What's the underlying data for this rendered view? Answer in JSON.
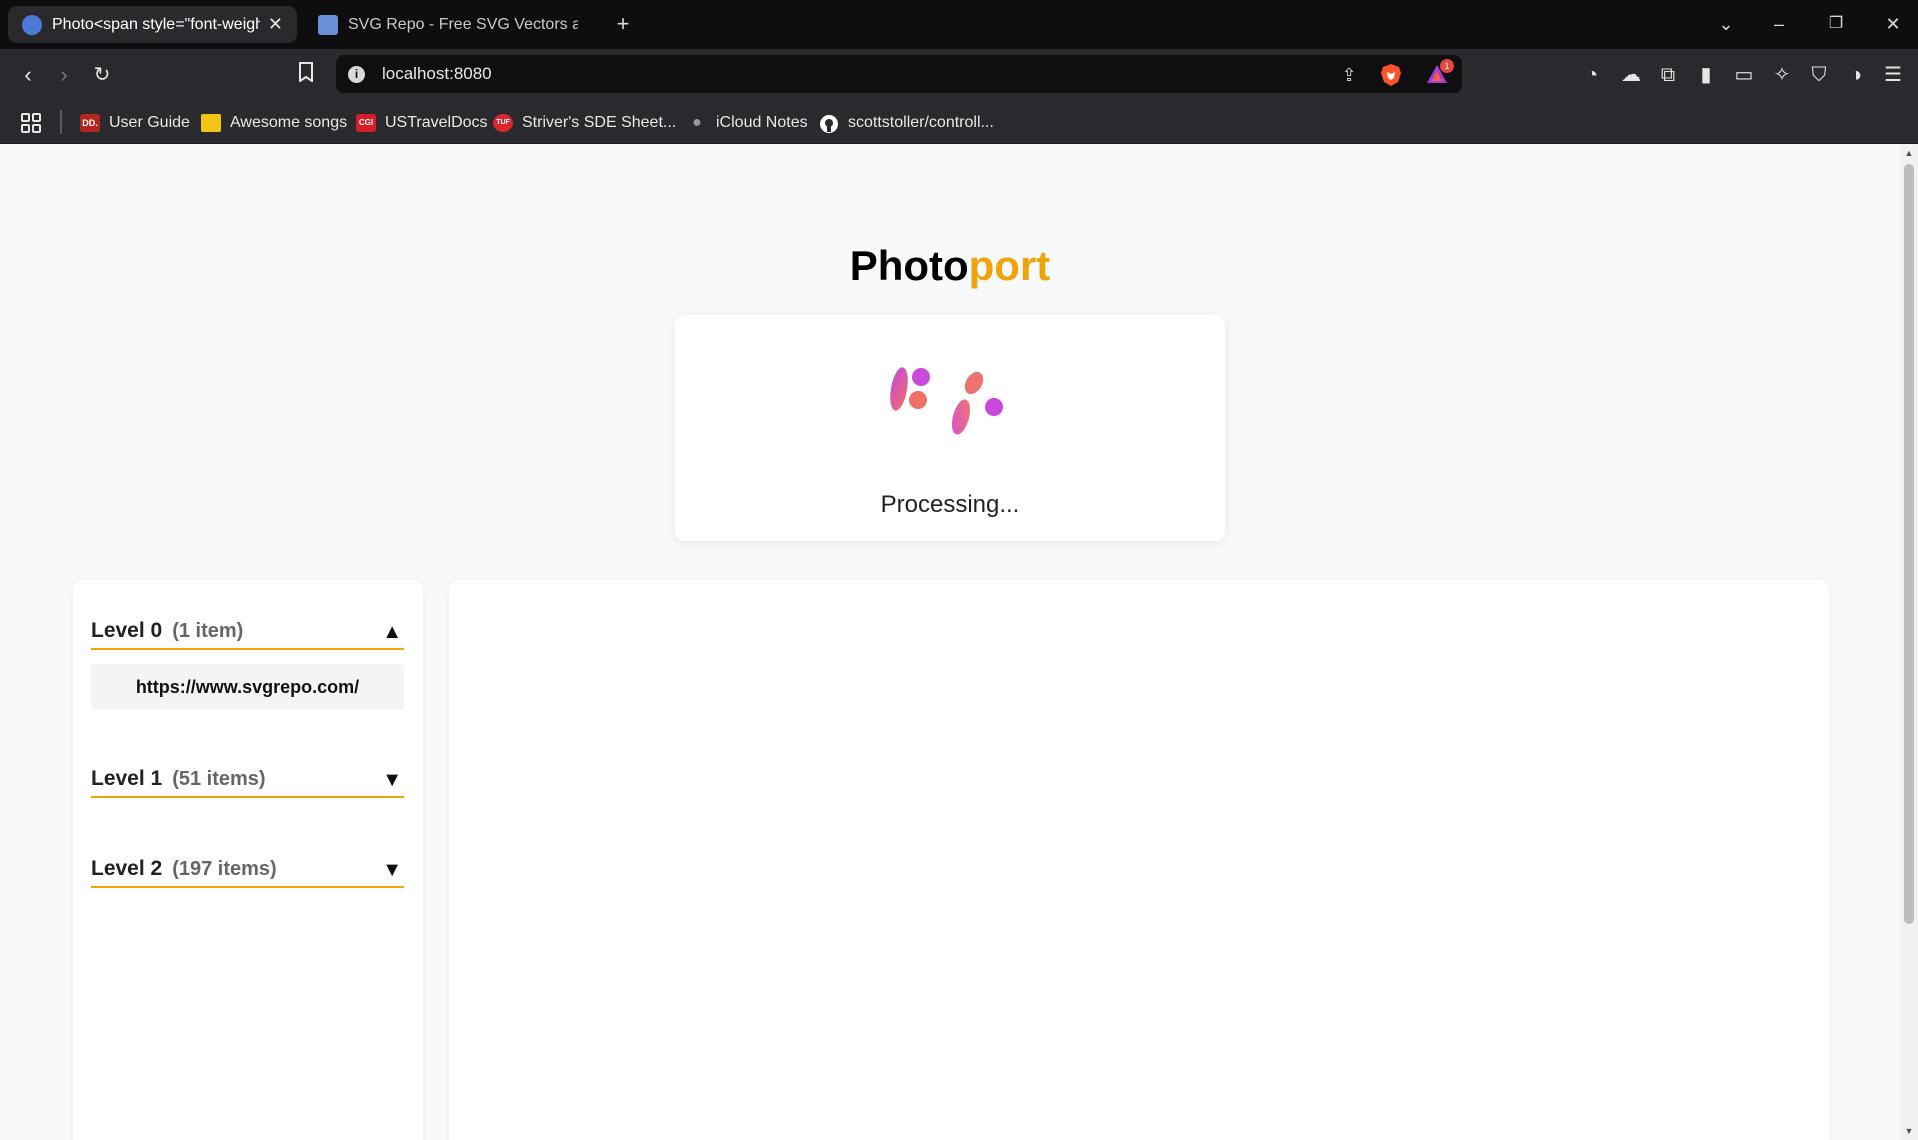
{
  "browser": {
    "tabs": [
      {
        "title": "Photo<span style=\"font-weight",
        "active": true
      },
      {
        "title": "SVG Repo - Free SVG Vectors and Ic",
        "active": false
      }
    ],
    "new_tab_label": "+",
    "address": "localhost:8080",
    "notification_count": "1",
    "bookmarks": [
      {
        "label": "User Guide",
        "icon": "dd-logo",
        "color": "#b3261e",
        "icon_text": "DD."
      },
      {
        "label": "Awesome songs",
        "icon": "folder-icon",
        "color": "#f2c418",
        "icon_text": ""
      },
      {
        "label": "USTravelDocs",
        "icon": "cgi-logo",
        "color": "#d71e28",
        "icon_text": "CGI"
      },
      {
        "label": "Striver's SDE Sheet...",
        "icon": "tuf-logo",
        "color": "#d9262c",
        "icon_text": "TUF"
      },
      {
        "label": "iCloud Notes",
        "icon": "apple-logo",
        "color": "#9a9a9a",
        "icon_text": ""
      },
      {
        "label": "scottstoller/controll...",
        "icon": "github-icon",
        "color": "#ffffff",
        "icon_text": ""
      }
    ]
  },
  "app": {
    "title_main": "Photo",
    "title_accent": "port",
    "accent_color": "#f0a30a",
    "processing_text": "Processing...",
    "levels": [
      {
        "name": "Level 0",
        "count": "(1 item)",
        "toggle": "▲",
        "expanded": true,
        "items": [
          "https://www.svgrepo.com/"
        ]
      },
      {
        "name": "Level 1",
        "count": "(51 items)",
        "toggle": "▼",
        "expanded": false
      },
      {
        "name": "Level 2",
        "count": "(197 items)",
        "toggle": "▼",
        "expanded": false
      }
    ]
  }
}
